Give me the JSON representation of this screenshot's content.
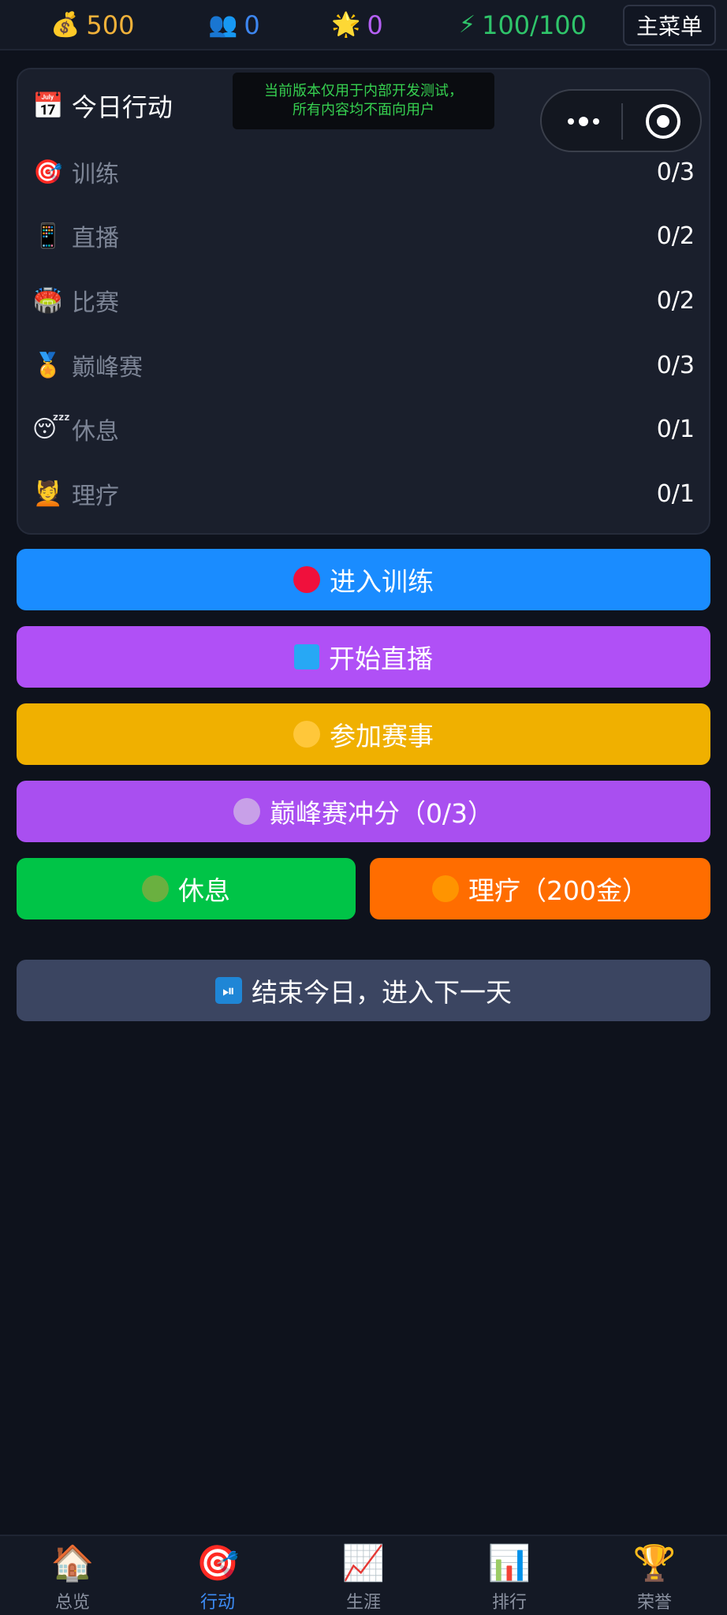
{
  "topbar": {
    "gold": {
      "icon": "💰",
      "value": "500",
      "color": "#f0b13a"
    },
    "fans": {
      "icon": "👥",
      "value": "0",
      "color": "#3d86f0"
    },
    "reputation": {
      "icon": "🌟",
      "value": "0",
      "color": "#b560f5"
    },
    "energy": {
      "icon": "⚡",
      "value": "100/100",
      "color": "#2fc46a"
    },
    "menu_label": "主菜单"
  },
  "notice": {
    "line1": "当前版本仅用于内部开发测试，",
    "line2": "所有内容均不面向用户"
  },
  "today": {
    "icon": "📅",
    "title": "今日行动",
    "actions": [
      {
        "icon": "🎯",
        "name": "训练",
        "count": "0/3"
      },
      {
        "icon": "📱",
        "name": "直播",
        "count": "0/2"
      },
      {
        "icon": "🏟️",
        "name": "比赛",
        "count": "0/2"
      },
      {
        "icon": "🏅",
        "name": "巅峰赛",
        "count": "0/3"
      },
      {
        "icon": "😴",
        "name": "休息",
        "count": "0/1"
      },
      {
        "icon": "💆",
        "name": "理疗",
        "count": "0/1"
      }
    ]
  },
  "buttons": {
    "train": {
      "label": "进入训练",
      "icon_color": "#f0103c"
    },
    "live": {
      "label": "开始直播",
      "icon_color": "#27a8f5"
    },
    "match": {
      "label": "参加赛事",
      "icon_color": "#ffc73a"
    },
    "peak": {
      "label": "巅峰赛冲分（0/3）",
      "icon_color": "#c8a0e8"
    },
    "rest": {
      "label": "休息",
      "icon_color": "#6ab040"
    },
    "therapy": {
      "label": "理疗（200金）",
      "icon_color": "#ff9400"
    },
    "next_day": {
      "icon": "⏯",
      "label": "结束今日，进入下一天"
    }
  },
  "tabs": [
    {
      "icon": "🏠",
      "label": "总览"
    },
    {
      "icon": "🎯",
      "label": "行动",
      "active": true
    },
    {
      "icon": "📈",
      "label": "生涯"
    },
    {
      "icon": "📊",
      "label": "排行"
    },
    {
      "icon": "🏆",
      "label": "荣誉"
    }
  ]
}
